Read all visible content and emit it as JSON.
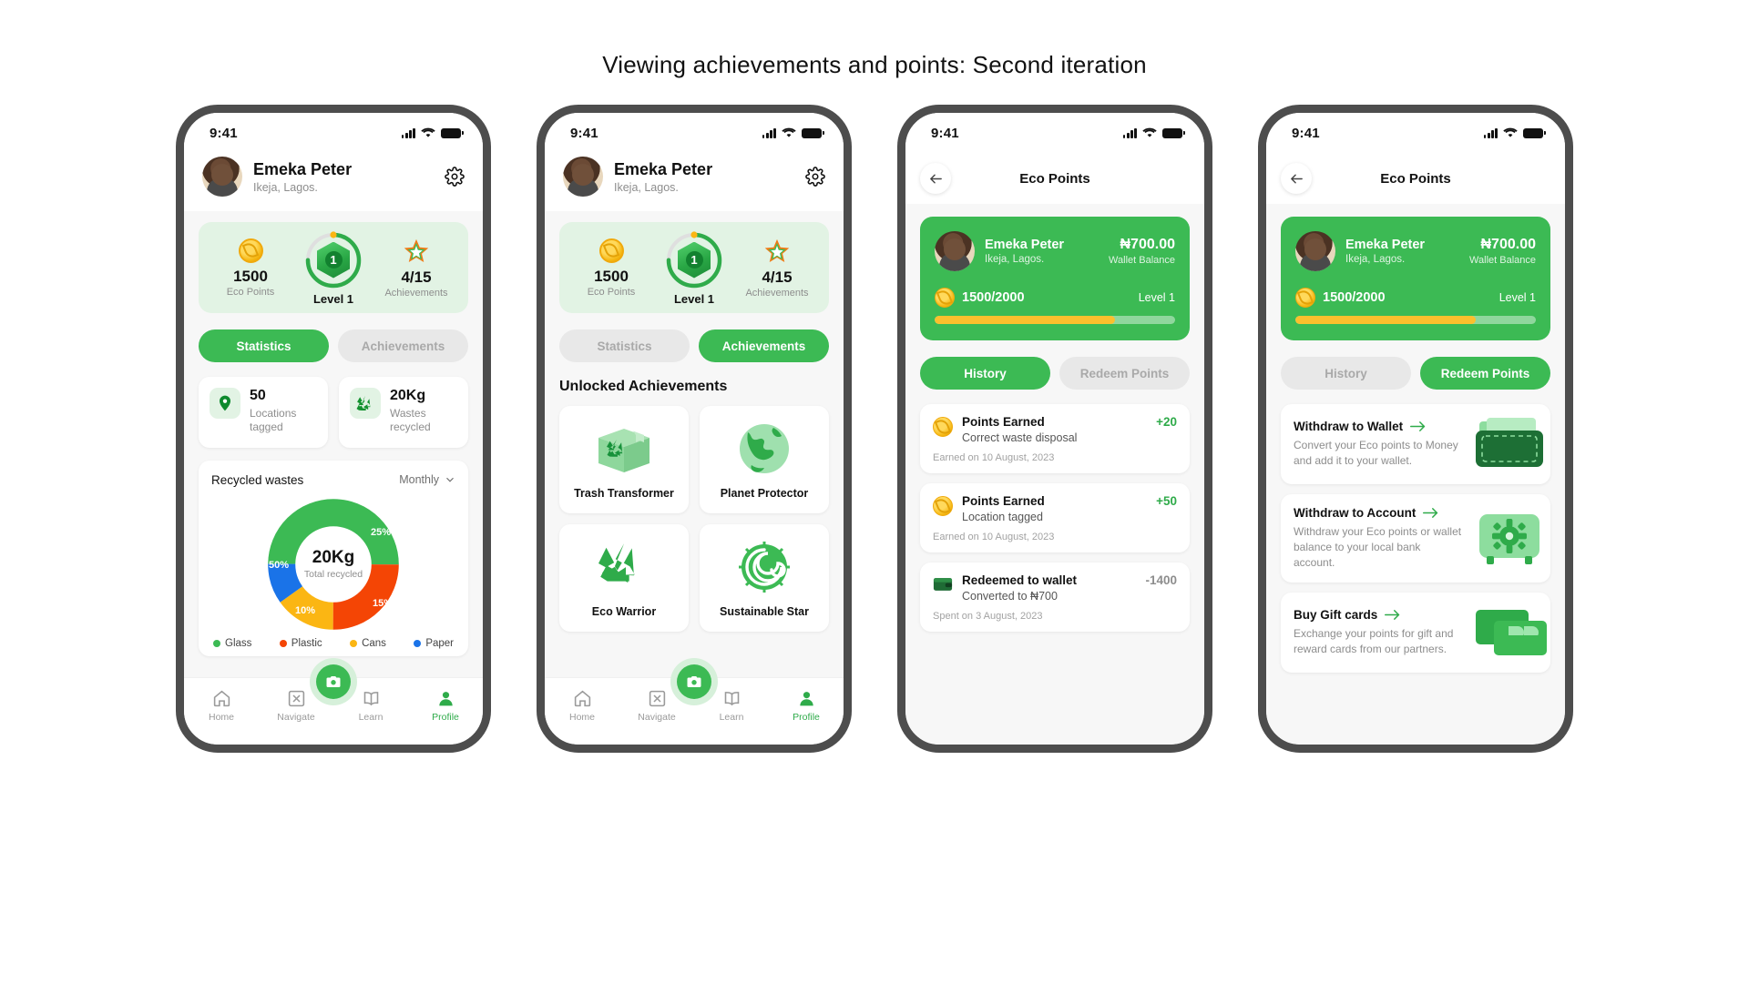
{
  "page": {
    "title": "Viewing achievements and points: Second iteration"
  },
  "status_bar": {
    "time": "9:41"
  },
  "user": {
    "name": "Emeka Peter",
    "location": "Ikeja, Lagos."
  },
  "stats_strip": {
    "eco_points_value": "1500",
    "eco_points_label": "Eco Points",
    "level_number": "1",
    "level_label": "Level 1",
    "achievements_value": "4/15",
    "achievements_label": "Achievements"
  },
  "profile_tabs": {
    "statistics": "Statistics",
    "achievements": "Achievements"
  },
  "metrics": [
    {
      "value": "50",
      "label": "Locations tagged",
      "icon": "location-pin-icon"
    },
    {
      "value": "20Kg",
      "label": "Wastes recycled",
      "icon": "recycle-icon"
    }
  ],
  "chart_card": {
    "title": "Recycled wastes",
    "period": "Monthly"
  },
  "chart_data": {
    "type": "pie",
    "title": "Recycled wastes",
    "subtitle": "Monthly",
    "center_value": "20Kg",
    "center_label": "Total recycled",
    "categories": [
      "Glass",
      "Plastic",
      "Cans",
      "Paper"
    ],
    "values": [
      50,
      25,
      15,
      10
    ],
    "value_labels": [
      "50%",
      "25%",
      "15%",
      "10%"
    ],
    "colors": [
      "#3cba54",
      "#f44505",
      "#fbb613",
      "#1a73e8"
    ],
    "legend_position": "bottom",
    "unit": "%"
  },
  "achievements_section": {
    "heading": "Unlocked Achievements",
    "items": [
      {
        "name": "Trash Transformer",
        "art": "recycle-box-art"
      },
      {
        "name": "Planet Protector",
        "art": "globe-art"
      },
      {
        "name": "Eco Warrior",
        "art": "recycle-arrows-art"
      },
      {
        "name": "Sustainable Star",
        "art": "spiral-sun-art"
      }
    ]
  },
  "bottom_nav": {
    "items": [
      {
        "label": "Home",
        "icon": "home-icon"
      },
      {
        "label": "Navigate",
        "icon": "navigate-icon"
      },
      {
        "label": "Learn",
        "icon": "book-icon"
      },
      {
        "label": "Profile",
        "icon": "person-icon"
      }
    ],
    "active": "Profile",
    "fab_icon": "camera-icon"
  },
  "eco_points": {
    "header_title": "Eco Points",
    "back_icon": "arrow-left-icon",
    "balance_card": {
      "name": "Emeka Peter",
      "location": "Ikeja, Lagos.",
      "wallet_balance": "₦700.00",
      "wallet_balance_label": "Wallet Balance",
      "points_progress": "1500/2000",
      "level": "Level 1",
      "progress_percent": 75
    },
    "tabs": {
      "history": "History",
      "redeem": "Redeem Points"
    },
    "history_items": [
      {
        "title": "Points Earned",
        "subtitle": "Correct waste disposal",
        "amount": "+20",
        "amount_kind": "pos",
        "date": "Earned on 10 August, 2023",
        "icon": "coin-icon"
      },
      {
        "title": "Points Earned",
        "subtitle": "Location tagged",
        "amount": "+50",
        "amount_kind": "pos",
        "date": "Earned on 10 August, 2023",
        "icon": "coin-icon"
      },
      {
        "title": "Redeemed to wallet",
        "subtitle": "Converted to ₦700",
        "amount": "-1400",
        "amount_kind": "neg",
        "date": "Spent on 3 August, 2023",
        "icon": "wallet-icon"
      }
    ],
    "redeem_items": [
      {
        "title": "Withdraw to Wallet",
        "description": "Convert your Eco points to Money and add it to your wallet.",
        "art": "wallet-art"
      },
      {
        "title": "Withdraw to Account",
        "description": "Withdraw your Eco points or wallet balance to your local bank account.",
        "art": "safe-art"
      },
      {
        "title": "Buy Gift cards",
        "description": "Exchange your points for gift and reward cards from our partners.",
        "art": "giftcard-art"
      }
    ]
  }
}
